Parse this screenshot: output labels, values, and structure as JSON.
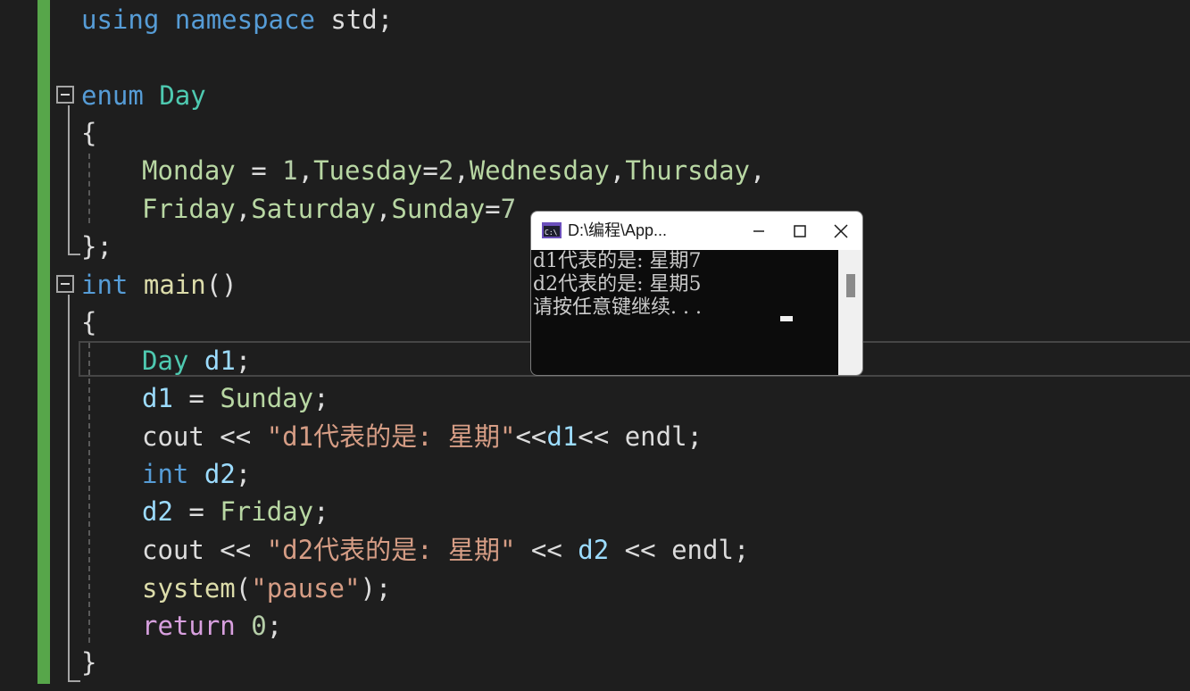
{
  "editor": {
    "line_using": {
      "kw1": "using",
      "kw2": "namespace",
      "ident": "std",
      "semi": ";"
    },
    "line_enum": {
      "kw": "enum",
      "type": "Day"
    },
    "open_brace": "{",
    "enum_line1": [
      {
        "t": "Monday",
        "c": "enm"
      },
      {
        "t": " = ",
        "c": "pl"
      },
      {
        "t": "1",
        "c": "num"
      },
      {
        "t": ",",
        "c": "pl"
      },
      {
        "t": "Tuesday",
        "c": "enm"
      },
      {
        "t": "=",
        "c": "pl"
      },
      {
        "t": "2",
        "c": "num"
      },
      {
        "t": ",",
        "c": "pl"
      },
      {
        "t": "Wednesday",
        "c": "enm"
      },
      {
        "t": ",",
        "c": "pl"
      },
      {
        "t": "Thursday",
        "c": "enm"
      },
      {
        "t": ",",
        "c": "pl"
      }
    ],
    "enum_line2": [
      {
        "t": "Friday",
        "c": "enm"
      },
      {
        "t": ",",
        "c": "pl"
      },
      {
        "t": "Saturday",
        "c": "enm"
      },
      {
        "t": ",",
        "c": "pl"
      },
      {
        "t": "Sunday",
        "c": "enm"
      },
      {
        "t": "=",
        "c": "pl"
      },
      {
        "t": "7",
        "c": "num"
      }
    ],
    "close_enum": "};",
    "line_main": {
      "kw": "int",
      "fn": "main",
      "parens": "()"
    },
    "main_open": "{",
    "body_lines": [
      [
        {
          "t": "Day",
          "c": "typ"
        },
        {
          "t": " ",
          "c": "pl"
        },
        {
          "t": "d1",
          "c": "var"
        },
        {
          "t": ";",
          "c": "pl"
        }
      ],
      [
        {
          "t": "d1",
          "c": "var"
        },
        {
          "t": " = ",
          "c": "pl"
        },
        {
          "t": "Sunday",
          "c": "enm"
        },
        {
          "t": ";",
          "c": "pl"
        }
      ],
      [
        {
          "t": "cout",
          "c": "pl"
        },
        {
          "t": " << ",
          "c": "pl"
        },
        {
          "t": "\"d1代表的是: 星期\"",
          "c": "str"
        },
        {
          "t": "<<",
          "c": "pl"
        },
        {
          "t": "d1",
          "c": "var"
        },
        {
          "t": "<< ",
          "c": "pl"
        },
        {
          "t": "endl",
          "c": "pl"
        },
        {
          "t": ";",
          "c": "pl"
        }
      ],
      [
        {
          "t": "int",
          "c": "kw"
        },
        {
          "t": " ",
          "c": "pl"
        },
        {
          "t": "d2",
          "c": "var"
        },
        {
          "t": ";",
          "c": "pl"
        }
      ],
      [
        {
          "t": "d2",
          "c": "var"
        },
        {
          "t": " = ",
          "c": "pl"
        },
        {
          "t": "Friday",
          "c": "enm"
        },
        {
          "t": ";",
          "c": "pl"
        }
      ],
      [
        {
          "t": "cout",
          "c": "pl"
        },
        {
          "t": " << ",
          "c": "pl"
        },
        {
          "t": "\"d2代表的是: 星期\"",
          "c": "str"
        },
        {
          "t": " << ",
          "c": "pl"
        },
        {
          "t": "d2",
          "c": "var"
        },
        {
          "t": " << ",
          "c": "pl"
        },
        {
          "t": "endl",
          "c": "pl"
        },
        {
          "t": ";",
          "c": "pl"
        }
      ],
      [
        {
          "t": "system",
          "c": "fn"
        },
        {
          "t": "(",
          "c": "pl"
        },
        {
          "t": "\"pause\"",
          "c": "str"
        },
        {
          "t": ");",
          "c": "pl"
        }
      ],
      [
        {
          "t": "return",
          "c": "ctl"
        },
        {
          "t": " ",
          "c": "pl"
        },
        {
          "t": "0",
          "c": "num"
        },
        {
          "t": ";",
          "c": "pl"
        }
      ]
    ],
    "main_close": "}"
  },
  "console": {
    "title": "D:\\编程\\App...",
    "icon": "console-app-icon",
    "output": [
      "d1代表的是: 星期7",
      "d2代表的是: 星期5",
      "请按任意键继续. . ."
    ],
    "buttons": {
      "minimize": "minimize-icon",
      "maximize": "maximize-icon",
      "close": "close-icon"
    }
  },
  "colors": {
    "background": "#1e1e1e",
    "keyword": "#569cd6",
    "type": "#4ec9b0",
    "enum_member": "#b8d7a3",
    "variable": "#9cdcfe",
    "function": "#dcdcaa",
    "string": "#d69d85",
    "number": "#b5cea8",
    "control": "#d8a0df",
    "change_bar": "#57a64a"
  }
}
